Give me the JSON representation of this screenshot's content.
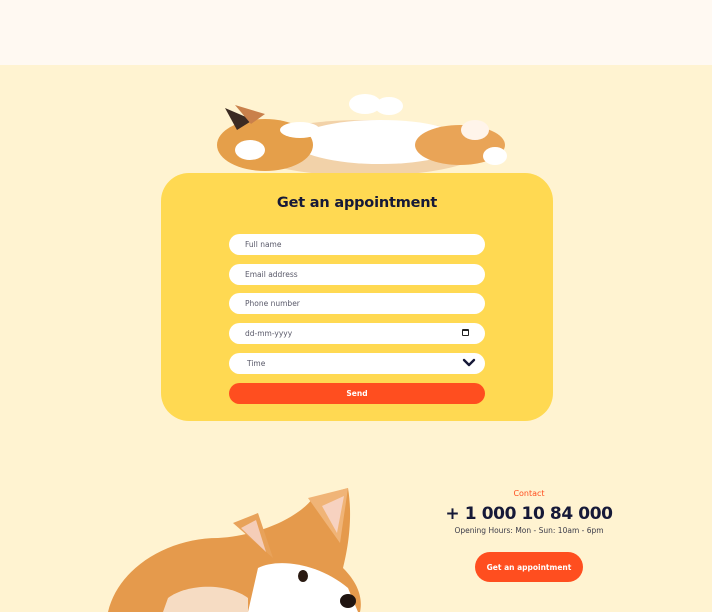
{
  "appointment": {
    "title": "Get an appointment",
    "fields": {
      "full_name_placeholder": "Full name",
      "email_placeholder": "Email address",
      "phone_placeholder": "Phone number",
      "date_placeholder": "dd-mm-yyyy",
      "time_selected": "Time"
    },
    "send_label": "Send"
  },
  "contact": {
    "label": "Contact",
    "phone": "+ 1 000 10 84 000",
    "hours": "Opening Hours: Mon - Sun: 10am - 6pm",
    "cta_label": "Get an appointment"
  },
  "colors": {
    "page_bg": "#fff3d1",
    "card_bg": "#ffd952",
    "accent": "#ff4e1f",
    "heading": "#161938"
  },
  "icons": [
    "calendar-icon",
    "chevron-down-icon"
  ]
}
